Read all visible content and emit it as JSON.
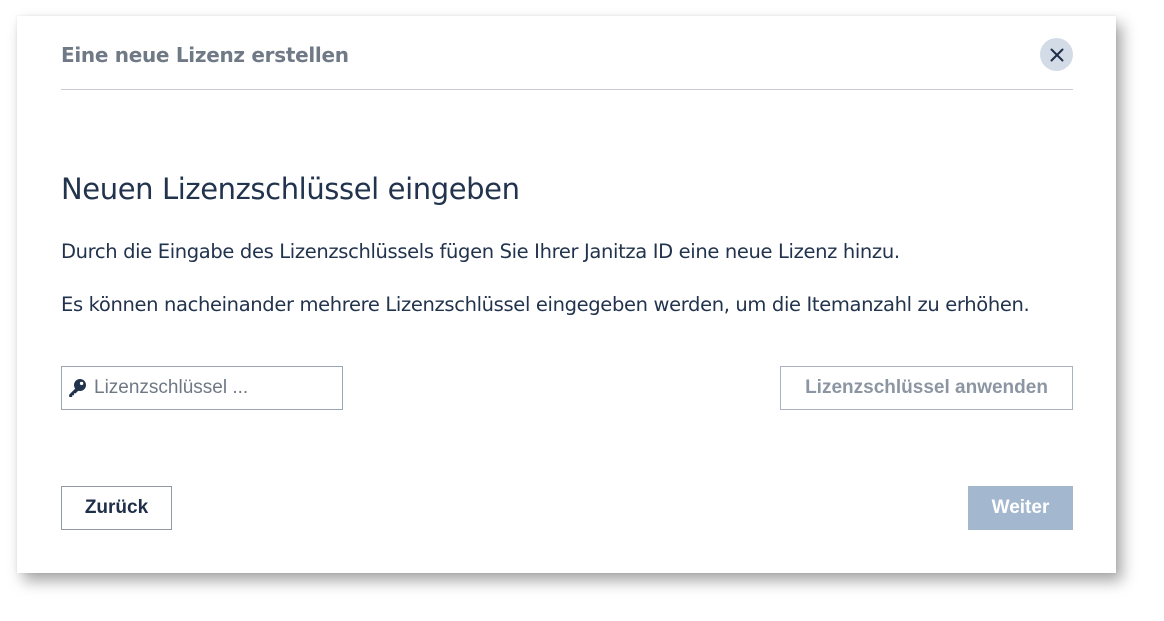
{
  "dialog": {
    "title": "Eine neue Lizenz erstellen",
    "close_icon": "close-icon"
  },
  "main": {
    "heading": "Neuen Lizenzschlüssel eingeben",
    "paragraph1": "Durch die Eingabe des Lizenzschlüssels fügen Sie Ihrer Janitza ID eine neue Lizenz hinzu.",
    "paragraph2": "Es können nacheinander mehrere Lizenzschlüssel eingegeben werden, um die Itemanzahl zu erhöhen."
  },
  "license_input": {
    "icon": "key-icon",
    "value": "",
    "placeholder": "Lizenzschlüssel ..."
  },
  "buttons": {
    "apply_label": "Lizenzschlüssel anwenden",
    "back_label": "Zurück",
    "next_label": "Weiter"
  },
  "colors": {
    "text_dark": "#22334d",
    "title_gray": "#707a86",
    "close_bg": "#d3dbe6",
    "next_bg_disabled": "#a3b7cf",
    "apply_text_disabled": "#8c96a2"
  }
}
